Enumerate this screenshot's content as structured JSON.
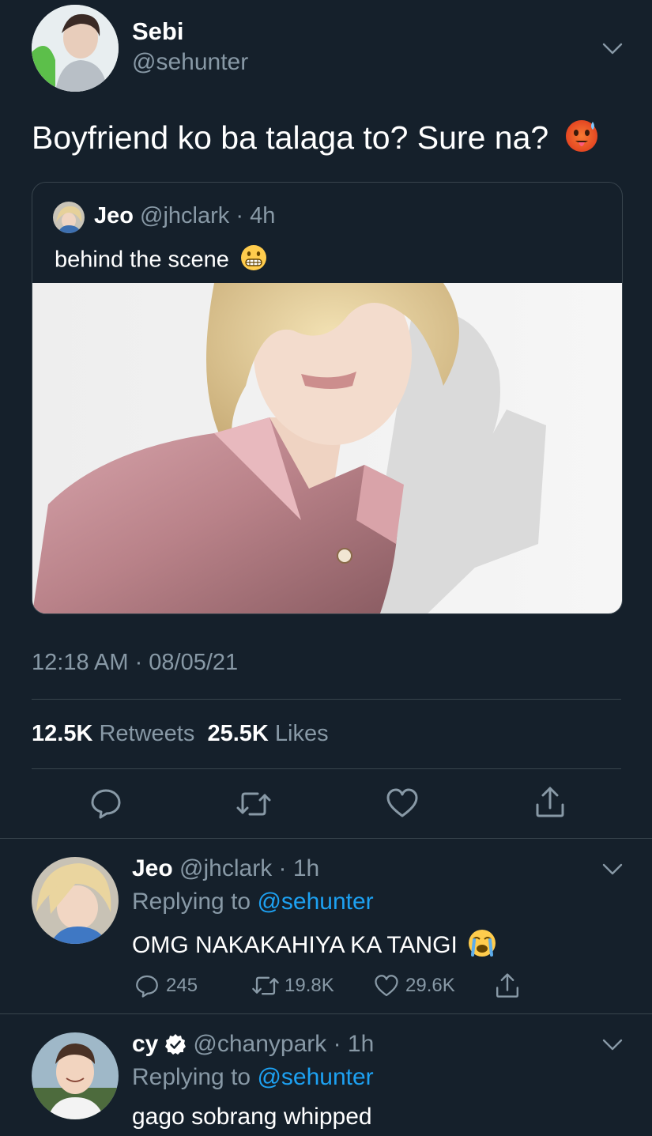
{
  "main_tweet": {
    "author_name": "Sebi",
    "author_handle": "@sehunter",
    "text": "Boyfriend ko ba talaga to? Sure na?",
    "text_emoji_icon": "hot-face-emoji-icon",
    "timestamp": "12:18 AM · 08/05/21",
    "retweets_count": "12.5K",
    "retweets_label": "Retweets",
    "likes_count": "25.5K",
    "likes_label": "Likes"
  },
  "quoted_tweet": {
    "author_name": "Jeo",
    "author_handle": "@jhclark",
    "time": "4h",
    "text": "behind the scene",
    "text_emoji_icon": "grimacing-emoji-icon"
  },
  "replies": [
    {
      "author_name": "Jeo",
      "author_handle": "@jhclark",
      "time": "1h",
      "replying_prefix": "Replying to",
      "replying_handle": "@sehunter",
      "text": "OMG NAKAKAHIYA KA TANGI",
      "text_emoji_icon": "loudly-crying-emoji-icon",
      "reply_count": "245",
      "retweet_count": "19.8K",
      "like_count": "29.6K"
    },
    {
      "author_name": "cy",
      "verified": true,
      "author_handle": "@chanypark",
      "time": "1h",
      "replying_prefix": "Replying to",
      "replying_handle": "@sehunter",
      "text": "gago sobrang whipped"
    }
  ],
  "colors": {
    "background": "#15202b",
    "muted_text": "#8899a6",
    "link": "#1da1f2",
    "divider": "#38444d"
  }
}
